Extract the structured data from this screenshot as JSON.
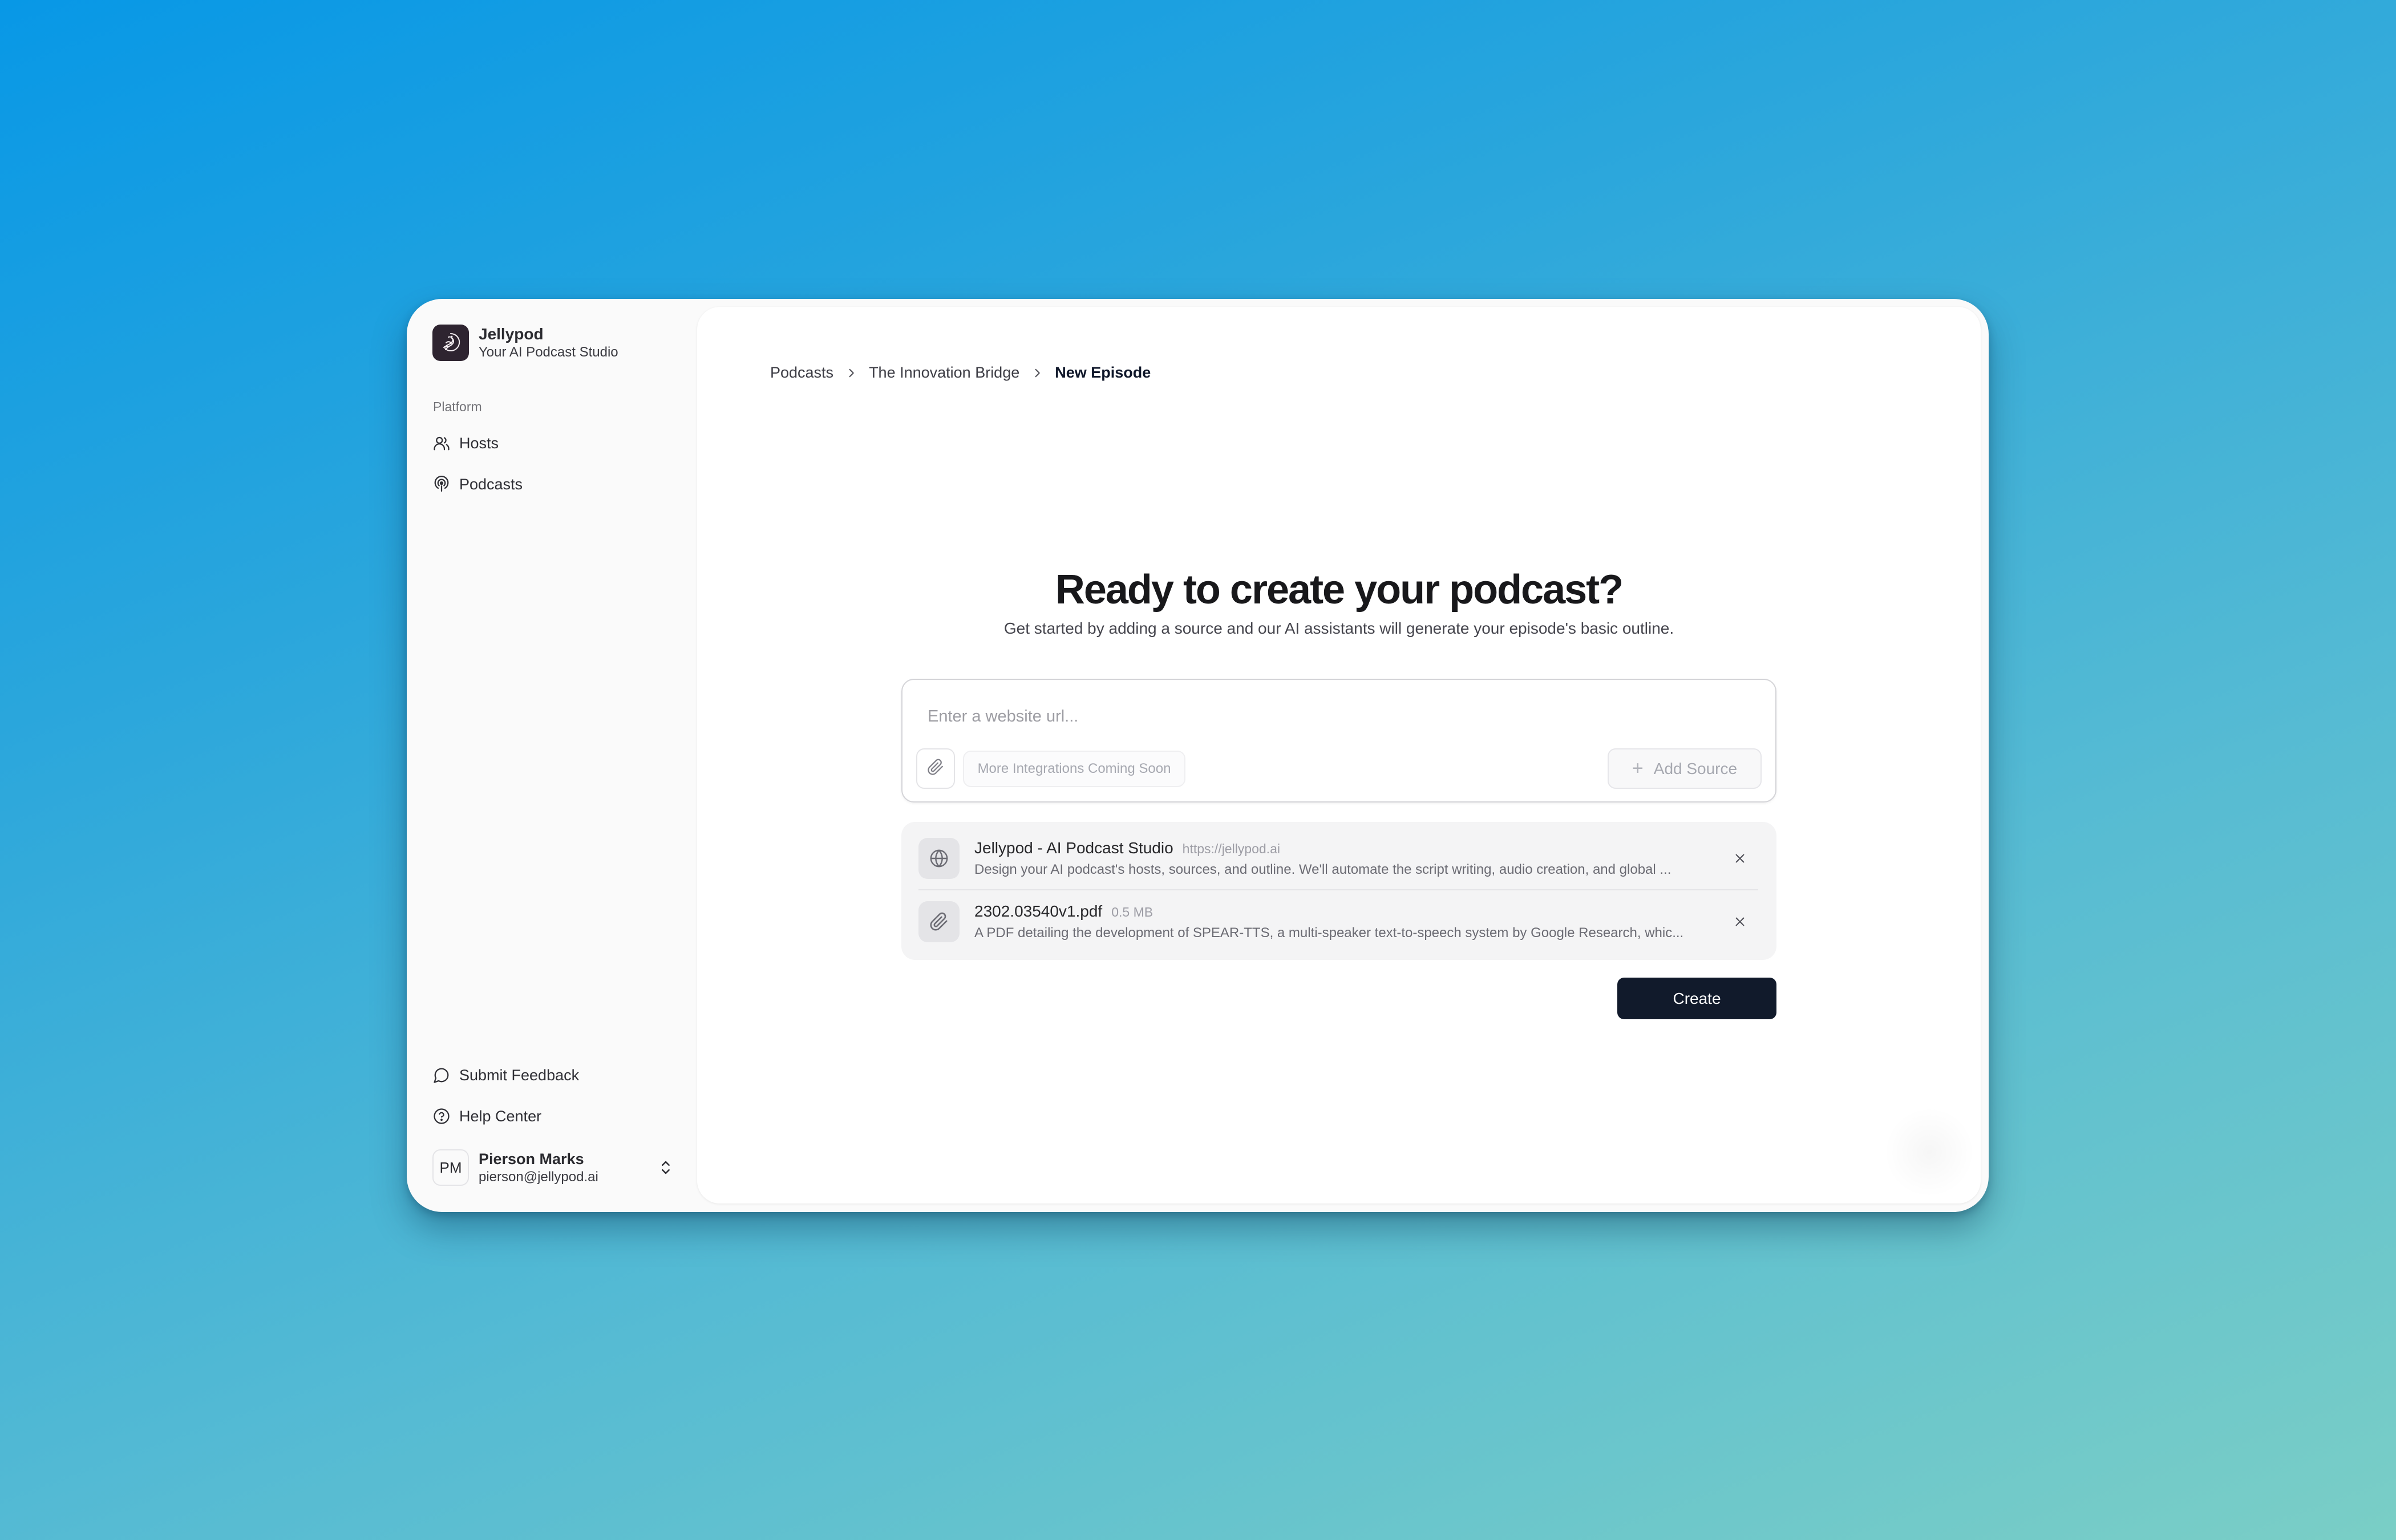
{
  "app": {
    "name": "Jellypod",
    "tagline": "Your AI Podcast Studio"
  },
  "sidebar": {
    "section_label": "Platform",
    "items": [
      {
        "label": "Hosts",
        "icon": "users-icon"
      },
      {
        "label": "Podcasts",
        "icon": "podcast-icon"
      }
    ],
    "footer_items": [
      {
        "label": "Submit Feedback",
        "icon": "message-circle-icon"
      },
      {
        "label": "Help Center",
        "icon": "help-circle-icon"
      }
    ],
    "user": {
      "initials": "PM",
      "name": "Pierson Marks",
      "email": "pierson@jellypod.ai"
    }
  },
  "breadcrumb": [
    {
      "label": "Podcasts"
    },
    {
      "label": "The Innovation Bridge"
    },
    {
      "label": "New Episode",
      "current": true
    }
  ],
  "hero": {
    "title": "Ready to create your podcast?",
    "subtitle": "Get started by adding a source and our AI assistants will generate your episode's basic outline."
  },
  "source_input": {
    "value": "",
    "placeholder": "Enter a website url...",
    "integrations_label": "More Integrations Coming Soon",
    "add_source_label": "Add Source"
  },
  "sources": [
    {
      "type": "website",
      "icon": "globe-icon",
      "title": "Jellypod - AI Podcast Studio",
      "meta": "https://jellypod.ai",
      "description": "Design your AI podcast's hosts, sources, and outline. We'll automate the script writing, audio creation, and global ..."
    },
    {
      "type": "file",
      "icon": "paperclip-icon",
      "title": "2302.03540v1.pdf",
      "meta": "0.5 MB",
      "description": "A PDF detailing the development of SPEAR-TTS, a multi-speaker text-to-speech system by Google Research, whic..."
    }
  ],
  "actions": {
    "create_label": "Create"
  },
  "colors": {
    "primary_button": "#111a2b",
    "background_start": "#0898E6",
    "background_end": "#7ACEC6",
    "logo_bg": "#2e2430"
  }
}
